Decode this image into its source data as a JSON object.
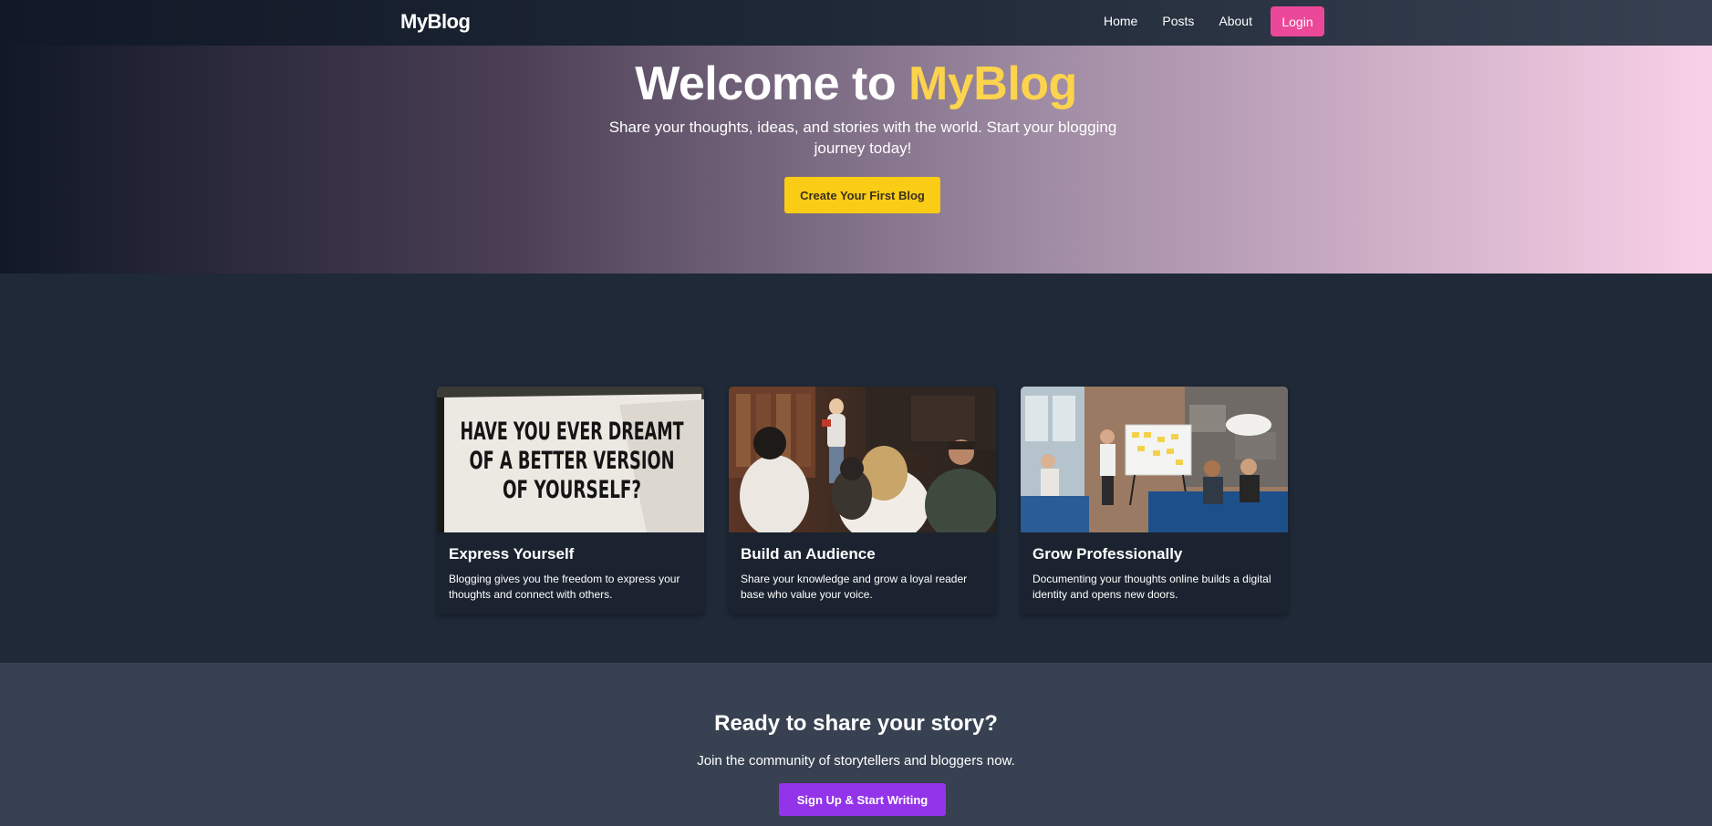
{
  "nav": {
    "brand": "MyBlog",
    "links": [
      {
        "label": "Home"
      },
      {
        "label": "Posts"
      },
      {
        "label": "About"
      }
    ],
    "login_label": "Login"
  },
  "hero": {
    "title_prefix": "Welcome to ",
    "title_accent": "MyBlog",
    "subtitle": "Share your thoughts, ideas, and stories with the world. Start your blogging journey today!",
    "cta_label": "Create Your First Blog"
  },
  "features": {
    "cards": [
      {
        "title": "Express Yourself",
        "text": "Blogging gives you the freedom to express your thoughts and connect with others.",
        "image_text": [
          "HAVE YOU EVER DREAMT",
          "OF A BETTER VERSION",
          "OF YOURSELF?"
        ]
      },
      {
        "title": "Build an Audience",
        "text": "Share your knowledge and grow a loyal reader base who value your voice."
      },
      {
        "title": "Grow Professionally",
        "text": "Documenting your thoughts online builds a digital identity and opens new doors."
      }
    ]
  },
  "cta": {
    "title": "Ready to share your story?",
    "subtitle": "Join the community of storytellers and bloggers now.",
    "button_label": "Sign Up & Start Writing"
  },
  "colors": {
    "accent_yellow": "#fcd34d",
    "login_pink": "#ec4899",
    "cta_purple": "#9333ea",
    "hero_button": "#facc15",
    "page_bg": "#1f2937",
    "cta_bg": "#374151"
  }
}
